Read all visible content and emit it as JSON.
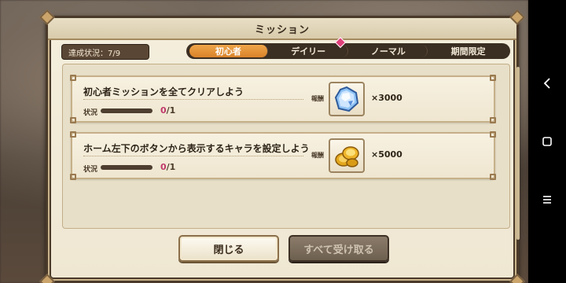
{
  "window": {
    "title": "ミッション"
  },
  "progress": {
    "text": "達成状況：7/9"
  },
  "tabs": [
    {
      "label": "初心者",
      "active": true,
      "badge": false
    },
    {
      "label": "デイリー",
      "active": false,
      "badge": true
    },
    {
      "label": "ノーマル",
      "active": false,
      "badge": false
    },
    {
      "label": "期間限定",
      "active": false,
      "badge": false
    }
  ],
  "missions": [
    {
      "title": "初心者ミッションを全てクリアしよう",
      "status_label": "状況",
      "progress_current": "0",
      "progress_total": "/1",
      "reward_label": "報酬",
      "reward_icon": "crystal-gem-icon",
      "reward_qty": "×3000"
    },
    {
      "title": "ホーム左下のボタンから表示するキャラを設定しよう",
      "status_label": "状況",
      "progress_current": "0",
      "progress_total": "/1",
      "reward_label": "報酬",
      "reward_icon": "gold-coins-icon",
      "reward_qty": "×5000"
    }
  ],
  "buttons": {
    "close": "閉じる",
    "receive_all": "すべて受け取る"
  },
  "colors": {
    "active_tab": "#e4952f",
    "progress_count": "#c03a6a",
    "window_bg": "#f4eedd"
  }
}
